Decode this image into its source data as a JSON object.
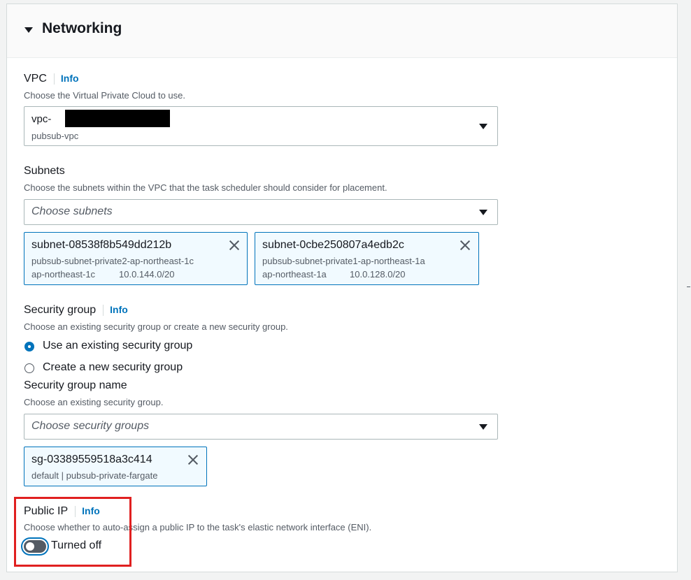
{
  "section": {
    "title": "Networking",
    "info_label": "Info"
  },
  "vpc": {
    "label": "VPC",
    "description": "Choose the Virtual Private Cloud to use.",
    "value_prefix": "vpc-",
    "value_sub": "pubsub-vpc"
  },
  "subnets": {
    "label": "Subnets",
    "description": "Choose the subnets within the VPC that the task scheduler should consider for placement.",
    "placeholder": "Choose subnets",
    "tokens": [
      {
        "id": "subnet-08538f8b549dd212b",
        "name": "pubsub-subnet-private2-ap-northeast-1c",
        "az": "ap-northeast-1c",
        "cidr": "10.0.144.0/20"
      },
      {
        "id": "subnet-0cbe250807a4edb2c",
        "name": "pubsub-subnet-private1-ap-northeast-1a",
        "az": "ap-northeast-1a",
        "cidr": "10.0.128.0/20"
      }
    ]
  },
  "security_group": {
    "label": "Security group",
    "description": "Choose an existing security group or create a new security group.",
    "options": [
      {
        "label": "Use an existing security group",
        "selected": true
      },
      {
        "label": "Create a new security group",
        "selected": false
      }
    ],
    "name_label": "Security group name",
    "name_description": "Choose an existing security group.",
    "placeholder": "Choose security groups",
    "tokens": [
      {
        "id": "sg-03389559518a3c414",
        "detail": "default | pubsub-private-fargate"
      }
    ]
  },
  "public_ip": {
    "label": "Public IP",
    "description": "Choose whether to auto-assign a public IP to the task's elastic network interface (ENI).",
    "toggle_label": "Turned off",
    "enabled": false
  },
  "colors": {
    "accent": "#0073bb",
    "highlight_border": "#e02020",
    "token_bg": "#f1faff"
  }
}
